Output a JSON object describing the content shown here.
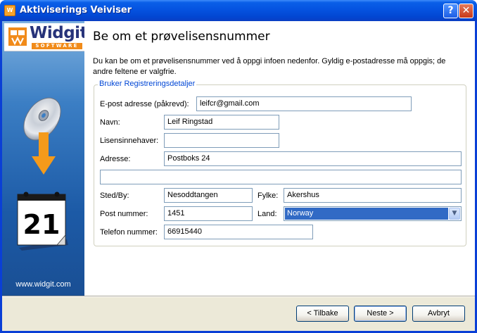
{
  "window": {
    "title": "Aktiviserings Veiviser",
    "help_glyph": "?",
    "close_glyph": "✕",
    "icon": "wizard-app-icon"
  },
  "sidebar": {
    "logo_text": "Widgit",
    "logo_sub": "SOFTWARE",
    "calendar_day": "21",
    "site_link": "www.widgit.com",
    "icons": [
      "cd-icon",
      "down-arrow-icon",
      "calendar-icon"
    ]
  },
  "page": {
    "title": "Be om et prøvelisensnummer",
    "intro": "Du kan be om et prøvelisensnummer ved å oppgi infoen nedenfor. Gyldig e-postadresse må oppgis; de andre feltene er valgfrie."
  },
  "form": {
    "group_title": "Bruker Registreringsdetaljer",
    "email_label": "E-post adresse (påkrevd):",
    "email_value": "leifcr@gmail.com",
    "name_label": "Navn:",
    "name_value": "Leif Ringstad",
    "holder_label": "Lisensinnehaver:",
    "holder_value": "",
    "address_label": "Adresse:",
    "address_value": "Postboks 24",
    "address2_value": "",
    "city_label": "Sted/By:",
    "city_value": "Nesoddtangen",
    "county_label": "Fylke:",
    "county_value": "Akershus",
    "postcode_label": "Post nummer:",
    "postcode_value": "1451",
    "country_label": "Land:",
    "country_value": "Norway",
    "phone_label": "Telefon nummer:",
    "phone_value": "66915440"
  },
  "buttons": {
    "back": "< Tilbake",
    "next": "Neste >",
    "cancel": "Avbryt"
  },
  "colors": {
    "titlebar": "#0553e0",
    "group_title": "#0046d5",
    "selection": "#316ac5",
    "logo_orange": "#f18b1a"
  }
}
